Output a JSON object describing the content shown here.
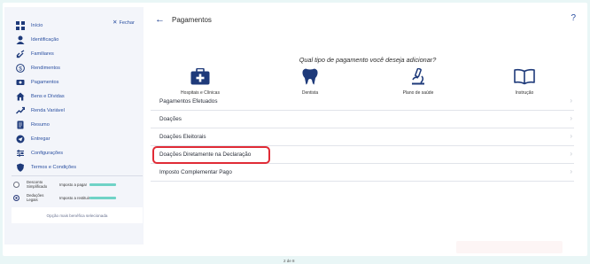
{
  "sidebar": {
    "close_label": "Fechar",
    "items": [
      {
        "label": "Início",
        "icon": "grid-icon"
      },
      {
        "label": "Identificação",
        "icon": "person-icon"
      },
      {
        "label": "Familiares",
        "icon": "link-icon"
      },
      {
        "label": "Rendimentos",
        "icon": "dollar-icon"
      },
      {
        "label": "Pagamentos",
        "icon": "money-icon"
      },
      {
        "label": "Bens e Dívidas",
        "icon": "home-icon"
      },
      {
        "label": "Renda Variável",
        "icon": "chart-icon"
      },
      {
        "label": "Resumo",
        "icon": "document-icon"
      },
      {
        "label": "Entregar",
        "icon": "send-icon"
      },
      {
        "label": "Configurações",
        "icon": "settings-icon"
      },
      {
        "label": "Termos e Condições",
        "icon": "shield-icon"
      }
    ],
    "modes": [
      {
        "label": "Desconto Simplificado",
        "tax_label": "Imposto a pagar",
        "checked": false
      },
      {
        "label": "Deduções Legais",
        "tax_label": "Imposto a restituir",
        "checked": true
      }
    ],
    "best_option_text": "Opção mais benéfica selecionada"
  },
  "main": {
    "title": "Pagamentos",
    "help": "?",
    "question": "Qual tipo de pagamento você deseja adicionar?",
    "payment_types": [
      {
        "label": "Hospitais e Clínicas",
        "icon": "medical-kit-icon"
      },
      {
        "label": "Dentista",
        "icon": "tooth-icon"
      },
      {
        "label": "Plano de saúde",
        "icon": "microscope-icon"
      },
      {
        "label": "Instrução",
        "icon": "book-icon"
      }
    ],
    "list": [
      {
        "label": "Pagamentos Efetuados"
      },
      {
        "label": "Doações"
      },
      {
        "label": "Doações Eleitorais"
      },
      {
        "label": "Doações Diretamente na Declaração"
      },
      {
        "label": "Imposto Complementar Pago"
      }
    ],
    "chevron": "›",
    "back_arrow": "←"
  },
  "footer": {
    "page": "2 de 8"
  },
  "colors": {
    "accent": "#2a4fa0",
    "highlight": "#e02b36",
    "primary_icon": "#1e3a7a",
    "tax_value": "#6fd3c6"
  }
}
